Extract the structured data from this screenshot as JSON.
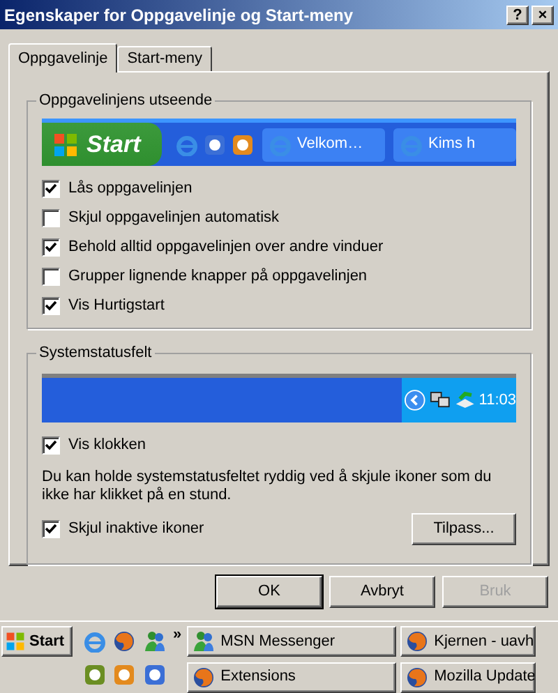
{
  "window": {
    "title": "Egenskaper for Oppgavelinje og Start-meny",
    "title_buttons": [
      "?",
      "×"
    ]
  },
  "tabs": [
    {
      "label": "Oppgavelinje",
      "selected": true
    },
    {
      "label": "Start-meny",
      "selected": false
    }
  ],
  "appearance": {
    "title": "Oppgavelinjens utseende",
    "preview": {
      "start_label": "Start",
      "tasks": [
        "Velkom…",
        "Kims h"
      ]
    },
    "options": [
      {
        "label": "Lås oppgavelinjen",
        "checked": true
      },
      {
        "label": "Skjul oppgavelinjen automatisk",
        "checked": false
      },
      {
        "label": "Behold alltid oppgavelinjen over andre vinduer",
        "checked": true
      },
      {
        "label": "Grupper lignende knapper på oppgavelinjen",
        "checked": false
      },
      {
        "label": "Vis Hurtigstart",
        "checked": true
      }
    ]
  },
  "notification_area": {
    "title": "Systemstatusfelt",
    "clock": "11:03",
    "show_clock": {
      "label": "Vis klokken",
      "checked": true
    },
    "description": "Du kan holde systemstatusfeltet ryddig ved å skjule ikoner som du ikke har klikket på en stund.",
    "hide_inactive": {
      "label": "Skjul inaktive ikoner",
      "checked": true
    },
    "customize_button": "Tilpass..."
  },
  "buttons": [
    {
      "label": "OK",
      "default": true,
      "disabled": false
    },
    {
      "label": "Avbryt",
      "default": false,
      "disabled": false
    },
    {
      "label": "Bruk",
      "default": false,
      "disabled": true
    }
  ],
  "taskbar": {
    "start_label": "Start",
    "more": "»",
    "tasks": [
      {
        "label": "MSN Messenger",
        "kind": "messenger"
      },
      {
        "label": "Kjernen - uavh",
        "kind": "browser"
      },
      {
        "label": "Extensions",
        "kind": "browser"
      },
      {
        "label": "Mozilla Update",
        "kind": "browser"
      }
    ]
  }
}
